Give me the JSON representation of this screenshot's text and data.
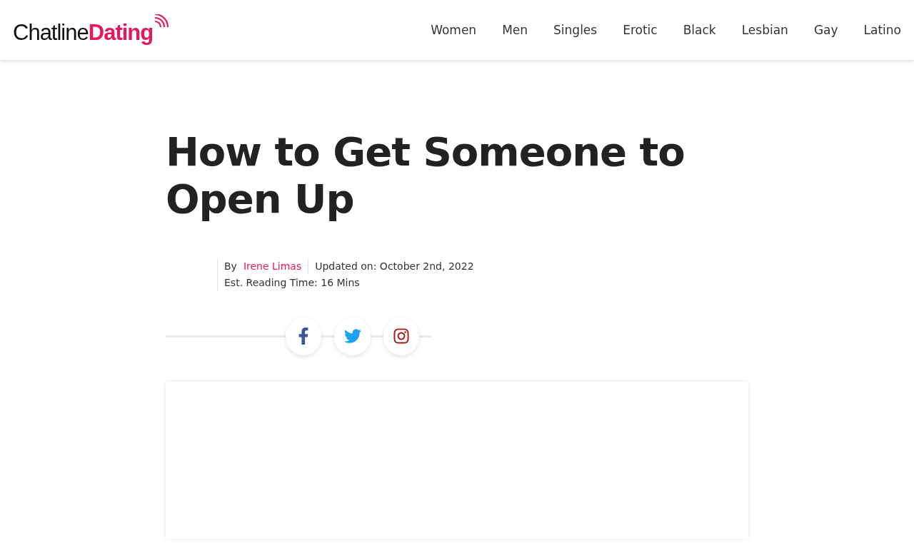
{
  "header": {
    "logo": {
      "first": "Chatline",
      "second": "Dating"
    },
    "nav": [
      {
        "label": "Women"
      },
      {
        "label": "Men"
      },
      {
        "label": "Singles"
      },
      {
        "label": "Erotic"
      },
      {
        "label": "Black"
      },
      {
        "label": "Lesbian"
      },
      {
        "label": "Gay"
      },
      {
        "label": "Latino"
      }
    ]
  },
  "article": {
    "title": "How to Get Someone to Open Up",
    "byline": {
      "prefix": "By",
      "author": "Irene Limas",
      "updated": "Updated on: October 2nd, 2022",
      "reading_time": "Est. Reading Time: 16 Mins"
    },
    "share": [
      {
        "kind": "facebook"
      },
      {
        "kind": "twitter"
      },
      {
        "kind": "instagram"
      }
    ]
  }
}
